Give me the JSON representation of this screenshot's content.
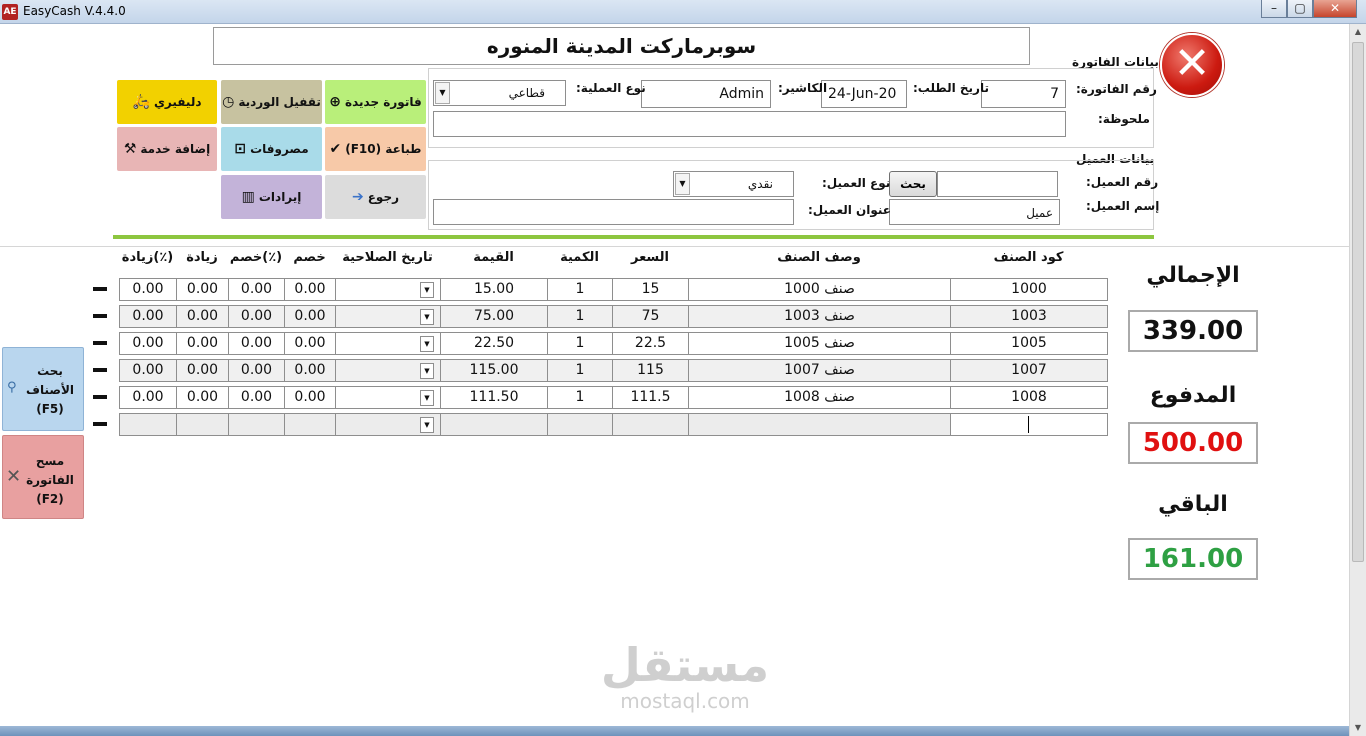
{
  "window": {
    "title": "EasyCash V.4.4.0",
    "icon": "AE",
    "min": "–",
    "max": "▢",
    "close": "✕"
  },
  "header": {
    "store_name": "سوبرماركت المدينة المنوره"
  },
  "invoice": {
    "group_title": "بيانات الفاتورة",
    "number_label": "رقم الفاتورة:",
    "number_value": "7",
    "date_label": "تاريخ الطلب:",
    "date_value": "24-Jun-20",
    "cashier_label": "الكاشير:",
    "cashier_value": "Admin",
    "op_type_label": "نوع العملية:",
    "op_type_value": "قطاعي",
    "note_label": "ملحوظة:",
    "note_value": ""
  },
  "customer": {
    "group_title": "بيانات العميل",
    "number_label": "رقم العميل:",
    "number_value": "",
    "search_label": "بحث",
    "type_label": "نوع العميل:",
    "type_value": "نقدي",
    "name_label": "إسم العميل:",
    "name_value": "عميل",
    "address_label": "عنوان العميل:",
    "address_value": ""
  },
  "actions": {
    "new_invoice": "فاتورة جديدة",
    "close_shift": "تقفيل الوردية",
    "delivery": "دليفيري",
    "print": "طباعة (F10)",
    "expenses": "مصروفات",
    "add_service": "إضافة خدمة",
    "back": "رجوع",
    "revenues": "إيرادات"
  },
  "grid": {
    "headers": {
      "code": "كود الصنف",
      "desc": "وصف الصنف",
      "price": "السعر",
      "qty": "الكمية",
      "value": "القيمة",
      "expiry": "تاريخ الصلاحية",
      "discount": "خصم",
      "discount_pct": "خصم(٪)",
      "increase": "زيادة",
      "increase_pct": "زيادة(٪)"
    },
    "rows": [
      {
        "code": "1000",
        "desc": "صنف 1000",
        "price": "15",
        "qty": "1",
        "value": "15.00",
        "discount": "0.00",
        "discount_pct": "0.00",
        "increase": "0.00",
        "increase_pct": "0.00"
      },
      {
        "code": "1003",
        "desc": "صنف 1003",
        "price": "75",
        "qty": "1",
        "value": "75.00",
        "discount": "0.00",
        "discount_pct": "0.00",
        "increase": "0.00",
        "increase_pct": "0.00"
      },
      {
        "code": "1005",
        "desc": "صنف 1005",
        "price": "22.5",
        "qty": "1",
        "value": "22.50",
        "discount": "0.00",
        "discount_pct": "0.00",
        "increase": "0.00",
        "increase_pct": "0.00"
      },
      {
        "code": "1007",
        "desc": "صنف 1007",
        "price": "115",
        "qty": "1",
        "value": "115.00",
        "discount": "0.00",
        "discount_pct": "0.00",
        "increase": "0.00",
        "increase_pct": "0.00"
      },
      {
        "code": "1008",
        "desc": "صنف 1008",
        "price": "111.5",
        "qty": "1",
        "value": "111.50",
        "discount": "0.00",
        "discount_pct": "0.00",
        "increase": "0.00",
        "increase_pct": "0.00"
      }
    ]
  },
  "side": {
    "search_items_l1": "بحث",
    "search_items_l2": "الأصناف",
    "search_items_l3": "(F5)",
    "clear_invoice_l1": "مسح",
    "clear_invoice_l2": "الفاتورة",
    "clear_invoice_l3": "(F2)"
  },
  "totals": {
    "total_label": "الإجمالي",
    "total_value": "339.00",
    "paid_label": "المدفوع",
    "paid_value": "500.00",
    "remaining_label": "الباقي",
    "remaining_value": "161.00"
  },
  "watermark": {
    "ar": "مستقل",
    "en": "mostaql.com"
  },
  "colors": {
    "paid": "#e01010",
    "remaining": "#2ea043",
    "accent_line": "#8dc63f",
    "new_invoice": "#b9ef7a",
    "close_shift": "#c7c2a0",
    "delivery": "#f2d100",
    "print": "#f7c9a8",
    "expenses": "#a9dbe9",
    "add_service": "#e8b5b5",
    "back": "#dcdcdc",
    "revenues": "#c3b3d9"
  }
}
